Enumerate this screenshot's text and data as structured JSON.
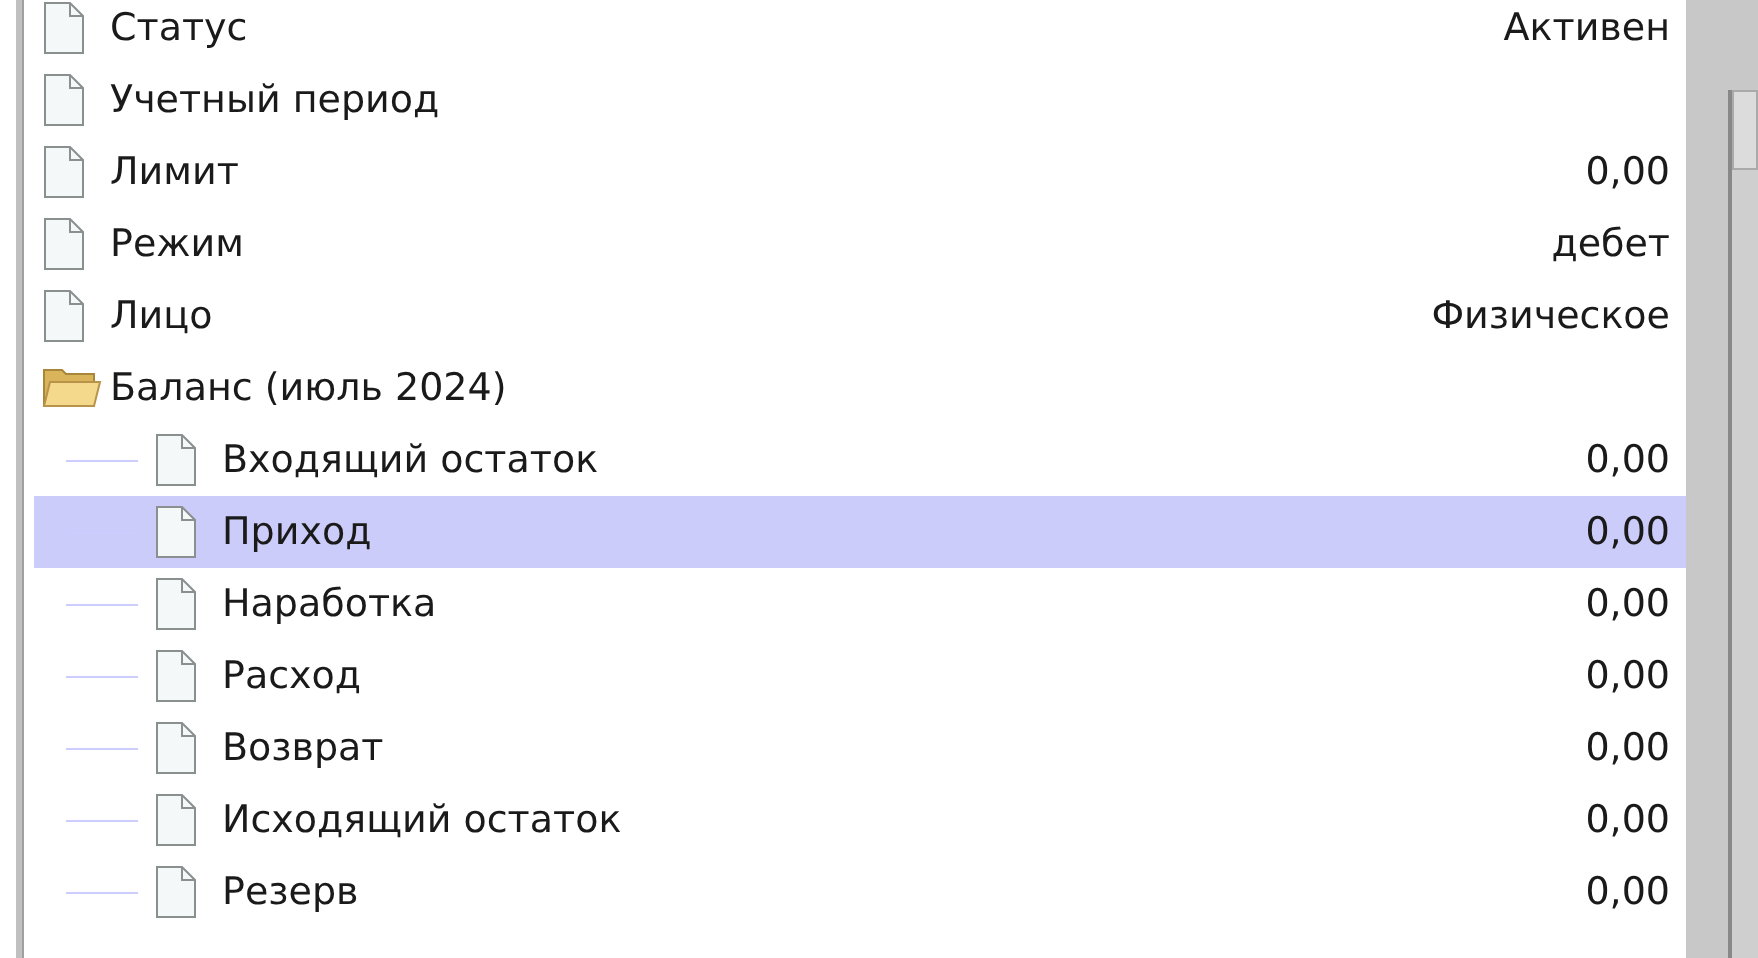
{
  "tree": [
    {
      "label": "Статус",
      "value": "Активен",
      "kind": "file",
      "selected": false
    },
    {
      "label": "Учетный период",
      "kind": "file",
      "selected": false
    },
    {
      "label": "Лимит",
      "value": "0,00",
      "kind": "file",
      "selected": false
    },
    {
      "label": "Режим",
      "value": "дебет",
      "kind": "file",
      "selected": false
    },
    {
      "label": "Лицо",
      "value": "Физическое",
      "kind": "file",
      "selected": false
    },
    {
      "label": "Баланс (июль 2024)",
      "kind": "folder",
      "expanded": true,
      "selected": false,
      "children": [
        {
          "label": "Входящий остаток",
          "value": "0,00",
          "kind": "file",
          "selected": false
        },
        {
          "label": "Приход",
          "value": "0,00",
          "kind": "file",
          "selected": true
        },
        {
          "label": "Наработка",
          "value": "0,00",
          "kind": "file",
          "selected": false
        },
        {
          "label": "Расход",
          "value": "0,00",
          "kind": "file",
          "selected": false
        },
        {
          "label": "Возврат",
          "value": "0,00",
          "kind": "file",
          "selected": false
        },
        {
          "label": "Исходящий остаток",
          "value": "0,00",
          "kind": "file",
          "selected": false
        },
        {
          "label": "Резерв",
          "value": "0,00",
          "kind": "file",
          "selected": false
        }
      ]
    }
  ]
}
